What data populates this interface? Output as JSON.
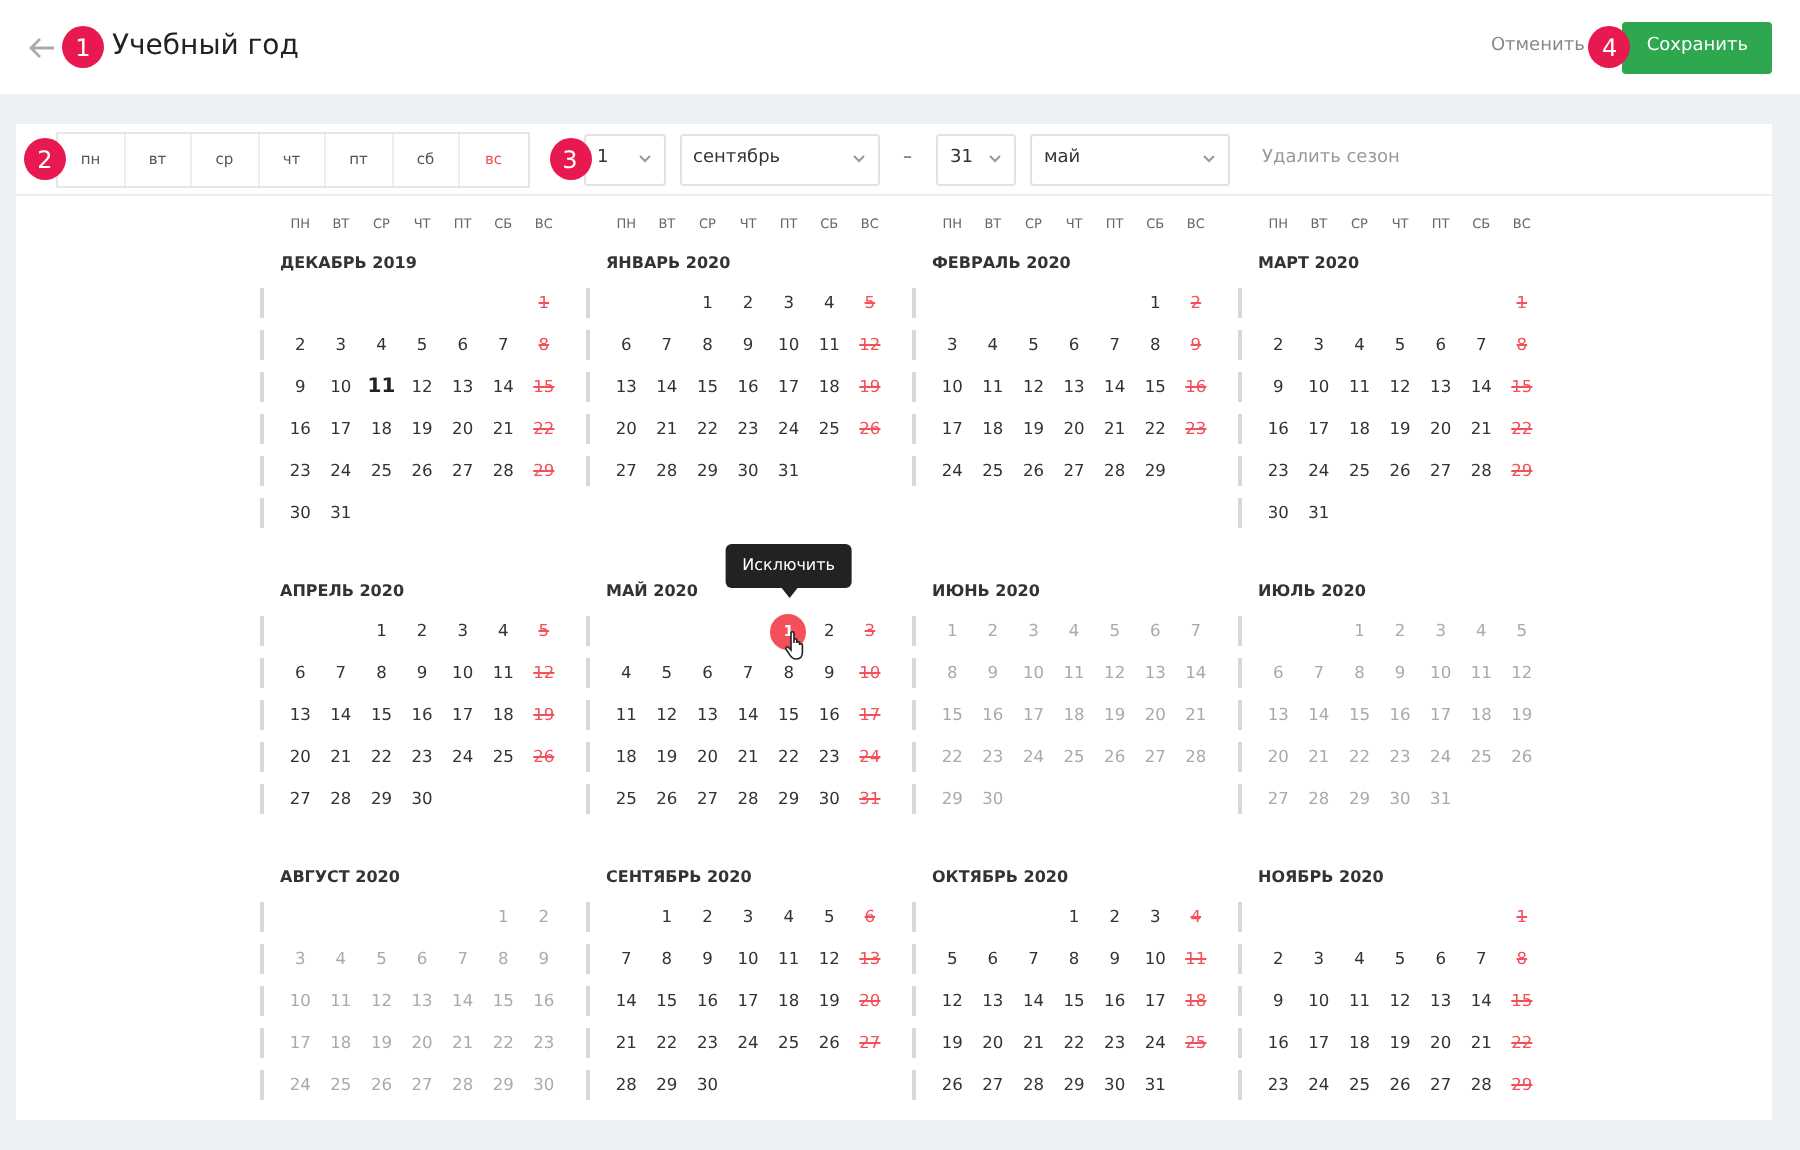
{
  "header": {
    "title": "Учебный год",
    "cancel": "Отменить",
    "save": "Сохранить"
  },
  "callouts": [
    "1",
    "2",
    "3",
    "4"
  ],
  "weekdays": [
    {
      "label": "пн",
      "off": false
    },
    {
      "label": "вт",
      "off": false
    },
    {
      "label": "ср",
      "off": false
    },
    {
      "label": "чт",
      "off": false
    },
    {
      "label": "пт",
      "off": false
    },
    {
      "label": "сб",
      "off": false
    },
    {
      "label": "вс",
      "off": true
    }
  ],
  "season": {
    "start_day": "1",
    "start_month": "сентябрь",
    "separator": "–",
    "end_day": "31",
    "end_month": "май",
    "delete": "Удалить сезон"
  },
  "column_headers": [
    [
      "ПН",
      "ВТ",
      "СР",
      "ЧТ",
      "ПТ",
      "СБ",
      "ВС"
    ],
    [
      "ПН",
      "ВТ",
      "СР",
      "ЧТ",
      "ПТ",
      "СБ",
      "ВС"
    ],
    [
      "ПН",
      "ВТ",
      "СР",
      "ЧТ",
      "ПТ",
      "СБ",
      "ВС"
    ],
    [
      "ПН",
      "ВТ",
      "СР",
      "ЧТ",
      "ПТ",
      "СБ",
      "ВС"
    ]
  ],
  "months": [
    {
      "title": "ДЕКАБРЬ 2019",
      "kind": "active",
      "weeks": [
        {
          "flush_end": true,
          "days": [
            "1"
          ]
        },
        [
          "2",
          "3",
          "4",
          "5",
          "6",
          "7",
          "8"
        ],
        [
          "9",
          "10",
          {
            "text": "11",
            "kind": "today"
          },
          "12",
          "13",
          "14",
          "15"
        ],
        [
          "16",
          "17",
          "18",
          "19",
          "20",
          "21",
          "22"
        ],
        [
          "23",
          "24",
          "25",
          "26",
          "27",
          "28",
          "29"
        ],
        [
          "30",
          "31"
        ]
      ]
    },
    {
      "title": "ЯНВАРЬ 2020",
      "kind": "active",
      "weeks": [
        {
          "flush_end": true,
          "days": [
            "1",
            "2",
            "3",
            "4",
            "5"
          ]
        },
        [
          "6",
          "7",
          "8",
          "9",
          "10",
          "11",
          "12"
        ],
        [
          "13",
          "14",
          "15",
          "16",
          "17",
          "18",
          "19"
        ],
        [
          "20",
          "21",
          "22",
          "23",
          "24",
          "25",
          "26"
        ],
        [
          "27",
          "28",
          "29",
          "30",
          "31"
        ]
      ]
    },
    {
      "title": "ФЕВРАЛЬ 2020",
      "kind": "active",
      "weeks": [
        {
          "flush_end": true,
          "days": [
            "1",
            "2"
          ]
        },
        [
          "3",
          "4",
          "5",
          "6",
          "7",
          "8",
          "9"
        ],
        [
          "10",
          "11",
          "12",
          "13",
          "14",
          "15",
          "16"
        ],
        [
          "17",
          "18",
          "19",
          "20",
          "21",
          "22",
          "23"
        ],
        [
          "24",
          "25",
          "26",
          "27",
          "28",
          "29"
        ]
      ]
    },
    {
      "title": "МАРТ 2020",
      "kind": "active",
      "weeks": [
        {
          "flush_end": true,
          "days": [
            "1"
          ]
        },
        [
          "2",
          "3",
          "4",
          "5",
          "6",
          "7",
          "8"
        ],
        [
          "9",
          "10",
          "11",
          "12",
          "13",
          "14",
          "15"
        ],
        [
          "16",
          "17",
          "18",
          "19",
          "20",
          "21",
          "22"
        ],
        [
          "23",
          "24",
          "25",
          "26",
          "27",
          "28",
          "29"
        ],
        [
          "30",
          "31"
        ]
      ]
    },
    {
      "title": "АПРЕЛЬ 2020",
      "kind": "active",
      "weeks": [
        {
          "flush_end": true,
          "days": [
            "1",
            "2",
            "3",
            "4",
            "5"
          ]
        },
        [
          "6",
          "7",
          "8",
          "9",
          "10",
          "11",
          "12"
        ],
        [
          "13",
          "14",
          "15",
          "16",
          "17",
          "18",
          "19"
        ],
        [
          "20",
          "21",
          "22",
          "23",
          "24",
          "25",
          "26"
        ],
        [
          "27",
          "28",
          "29",
          "30"
        ]
      ]
    },
    {
      "title": "МАЙ 2020",
      "kind": "active",
      "weeks": [
        {
          "flush_end": true,
          "days": [
            {
              "text": "1",
              "kind": "highlight",
              "tooltip": "Исключить"
            },
            "2",
            "3"
          ]
        },
        [
          "4",
          "5",
          "6",
          "7",
          "8",
          "9",
          "10"
        ],
        [
          "11",
          "12",
          "13",
          "14",
          "15",
          "16",
          "17"
        ],
        [
          "18",
          "19",
          "20",
          "21",
          "22",
          "23",
          "24"
        ],
        [
          "25",
          "26",
          "27",
          "28",
          "29",
          "30",
          "31"
        ]
      ]
    },
    {
      "title": "ИЮНЬ 2020",
      "kind": "inactive",
      "weeks": [
        [
          "1",
          "2",
          "3",
          "4",
          "5",
          "6",
          "7"
        ],
        [
          "8",
          "9",
          "10",
          "11",
          "12",
          "13",
          "14"
        ],
        [
          "15",
          "16",
          "17",
          "18",
          "19",
          "20",
          "21"
        ],
        [
          "22",
          "23",
          "24",
          "25",
          "26",
          "27",
          "28"
        ],
        [
          "29",
          "30"
        ]
      ]
    },
    {
      "title": "ИЮЛЬ 2020",
      "kind": "inactive",
      "weeks": [
        {
          "flush_end": true,
          "days": [
            "1",
            "2",
            "3",
            "4",
            "5"
          ]
        },
        [
          "6",
          "7",
          "8",
          "9",
          "10",
          "11",
          "12"
        ],
        [
          "13",
          "14",
          "15",
          "16",
          "17",
          "18",
          "19"
        ],
        [
          "20",
          "21",
          "22",
          "23",
          "24",
          "25",
          "26"
        ],
        [
          "27",
          "28",
          "29",
          "30",
          "31"
        ]
      ]
    },
    {
      "title": "АВГУСТ 2020",
      "kind": "inactive",
      "weeks": [
        {
          "flush_end": true,
          "days": [
            "1",
            "2"
          ]
        },
        [
          "3",
          "4",
          "5",
          "6",
          "7",
          "8",
          "9"
        ],
        [
          "10",
          "11",
          "12",
          "13",
          "14",
          "15",
          "16"
        ],
        [
          "17",
          "18",
          "19",
          "20",
          "21",
          "22",
          "23"
        ],
        [
          "24",
          "25",
          "26",
          "27",
          "28",
          "29",
          "30"
        ]
      ]
    },
    {
      "title": "СЕНТЯБРЬ 2020",
      "kind": "active",
      "weeks": [
        {
          "flush_end": true,
          "days": [
            "1",
            "2",
            "3",
            "4",
            "5",
            "6"
          ]
        },
        [
          "7",
          "8",
          "9",
          "10",
          "11",
          "12",
          "13"
        ],
        [
          "14",
          "15",
          "16",
          "17",
          "18",
          "19",
          "20"
        ],
        [
          "21",
          "22",
          "23",
          "24",
          "25",
          "26",
          "27"
        ],
        [
          "28",
          "29",
          "30"
        ]
      ]
    },
    {
      "title": "ОКТЯБРЬ 2020",
      "kind": "active",
      "weeks": [
        {
          "flush_end": true,
          "days": [
            "1",
            "2",
            "3",
            "4"
          ]
        },
        [
          "5",
          "6",
          "7",
          "8",
          "9",
          "10",
          "11"
        ],
        [
          "12",
          "13",
          "14",
          "15",
          "16",
          "17",
          "18"
        ],
        [
          "19",
          "20",
          "21",
          "22",
          "23",
          "24",
          "25"
        ],
        [
          "26",
          "27",
          "28",
          "29",
          "30",
          "31"
        ]
      ]
    },
    {
      "title": "НОЯБРЬ 2020",
      "kind": "active",
      "weeks": [
        {
          "flush_end": true,
          "days": [
            "1"
          ]
        },
        [
          "2",
          "3",
          "4",
          "5",
          "6",
          "7",
          "8"
        ],
        [
          "9",
          "10",
          "11",
          "12",
          "13",
          "14",
          "15"
        ],
        [
          "16",
          "17",
          "18",
          "19",
          "20",
          "21",
          "22"
        ],
        [
          "23",
          "24",
          "25",
          "26",
          "27",
          "28",
          "29"
        ]
      ]
    }
  ]
}
